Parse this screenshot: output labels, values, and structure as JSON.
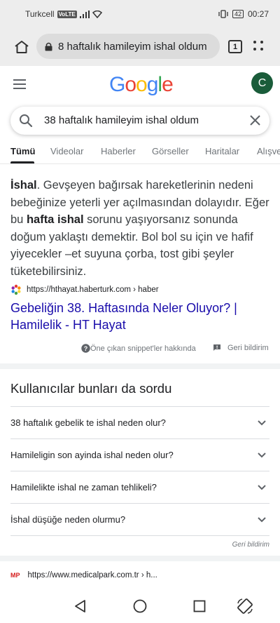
{
  "status_bar": {
    "carrier": "Turkcell",
    "volte": "VoLTE",
    "battery": "42",
    "time": "00:27"
  },
  "browser": {
    "url_text": "8 haftalık hamileyim ishal oldum",
    "tab_count": "1"
  },
  "google": {
    "logo": [
      "G",
      "o",
      "o",
      "g",
      "l",
      "e"
    ],
    "logo_colors": [
      "#4285F4",
      "#EA4335",
      "#FBBC05",
      "#4285F4",
      "#34A853",
      "#EA4335"
    ],
    "avatar_letter": "C",
    "avatar_color": "#1a5c3a"
  },
  "search": {
    "query": "38 haftalık hamileyim ishal oldum"
  },
  "tabs": [
    {
      "label": "Tümü",
      "active": true
    },
    {
      "label": "Videolar"
    },
    {
      "label": "Haberler"
    },
    {
      "label": "Görseller"
    },
    {
      "label": "Haritalar"
    },
    {
      "label": "Alışveriş"
    }
  ],
  "snippet": {
    "t1": "İshal",
    "t2": ". Gevşeyen bağırsak hareketlerinin nedeni bebeğinize yeterli yer açılmasından dolayıdır. Eğer bu ",
    "t3": "hafta ishal",
    "t4": " sorunu yaşıyorsanız sonunda doğum yaklaştı demektir. Bol bol su için ve hafif yiyecekler –et suyuna çorba, tost gibi şeyler tüketebilirsiniz.",
    "source_url": "https://hthayat.haberturk.com › haber",
    "title": "Gebeliğin 38. Haftasında Neler Oluyor? | Hamilelik - HT Hayat",
    "about_label": "Öne çıkan snippet'ler hakkında",
    "feedback_label": "Geri bildirim"
  },
  "paa": {
    "title": "Kullanıcılar bunları da sordu",
    "questions": [
      "38 haftalık gebelik te ishal neden olur?",
      "Hamileligin son ayinda ishal neden olur?",
      "Hamilelikte ishal ne zaman tehlikeli?",
      "İshal düşüğe neden olurmu?"
    ],
    "feedback_label": "Geri bildirim"
  },
  "next_result": {
    "logo_text": "MP",
    "source_url": "https://www.medicalpark.com.tr › h..."
  },
  "colors": {
    "link": "#1a0dab",
    "text": "#202124",
    "muted": "#70757a"
  }
}
